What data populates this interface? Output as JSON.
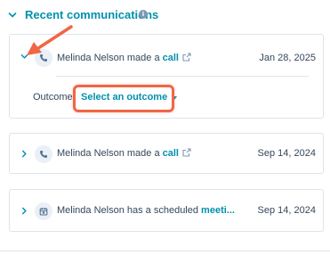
{
  "section": {
    "title": "Recent communications"
  },
  "activities": [
    {
      "text_prefix": "Melinda Nelson made a ",
      "link": "call",
      "date": "Jan 28, 2025",
      "expanded": true,
      "type_icon": "phone-icon"
    },
    {
      "text_prefix": "Melinda Nelson made a ",
      "link": "call",
      "date": "Sep 14, 2024",
      "expanded": false,
      "type_icon": "phone-icon"
    },
    {
      "text_prefix": "Melinda Nelson has a scheduled ",
      "link": "meeti...",
      "date": "Sep 14, 2024",
      "expanded": false,
      "type_icon": "calendar-icon"
    }
  ],
  "outcome": {
    "label": "Outcome",
    "select_value": "Select an outcome"
  },
  "colors": {
    "accent": "#0091ae",
    "text": "#33475b",
    "border": "#dfe3eb",
    "highlight": "#ef6745"
  }
}
